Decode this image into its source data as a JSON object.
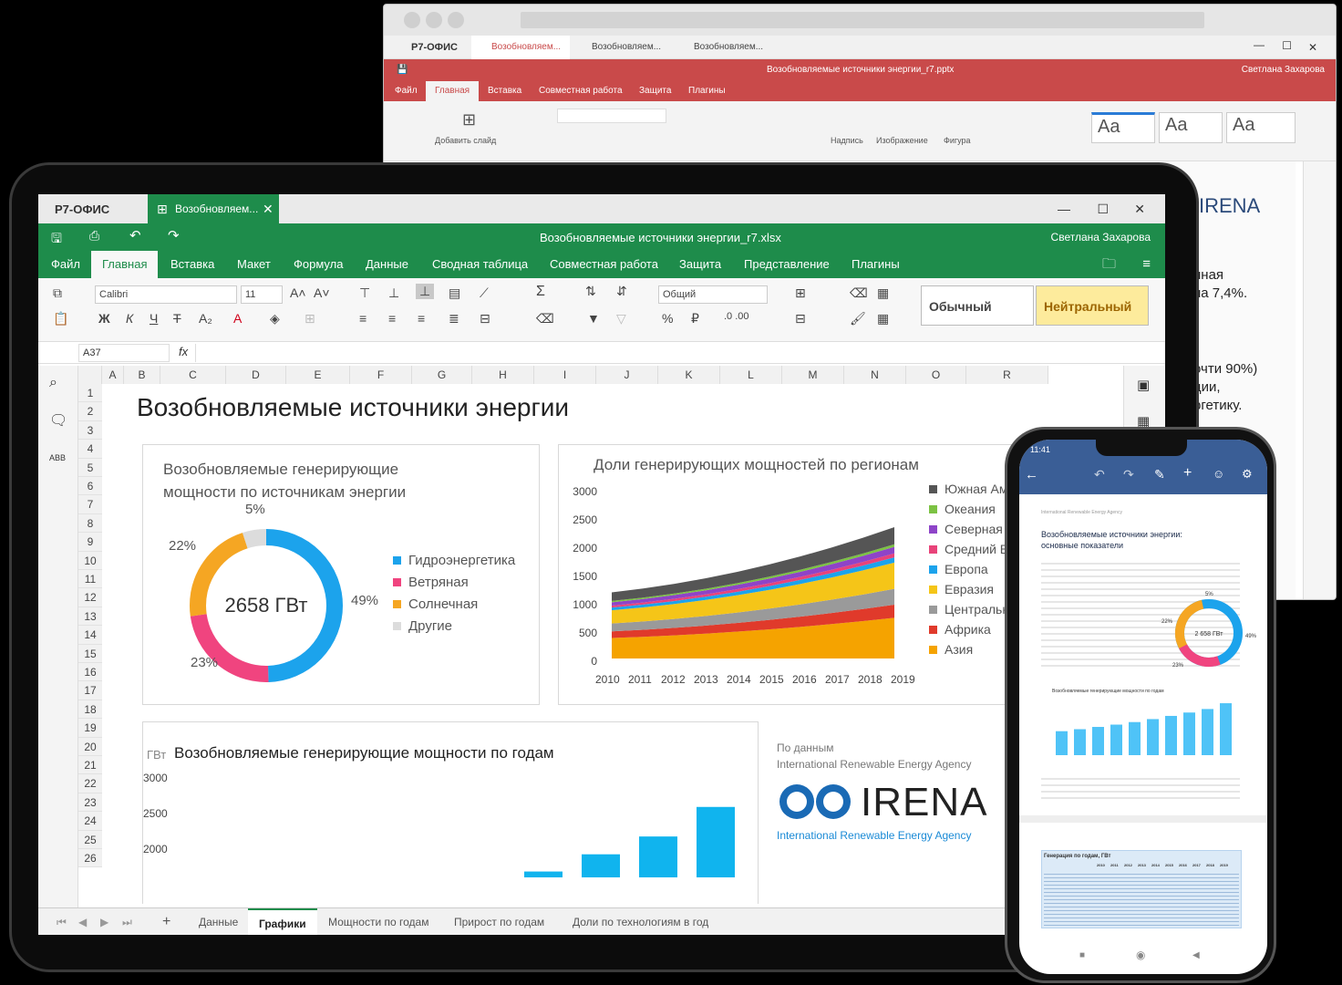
{
  "pres": {
    "logo": "Р7-ОФИС",
    "tabs": [
      "Возобновляем...",
      "Возобновляем...",
      "Возобновляем..."
    ],
    "file": "Возобновляемые источники энергии_r7.pptx",
    "user": "Светлана Захарова",
    "menu": [
      "Файл",
      "Главная",
      "Вставка",
      "Совместная работа",
      "Защита",
      "Плагины"
    ],
    "ribbon": {
      "add_slide": "Добавить слайд",
      "caption": "Надпись",
      "image": "Изображение",
      "shape": "Фигура",
      "theme": "Aa"
    },
    "visible_text": [
      "IRENA",
      "нная",
      "на 7,4%.",
      "очти 90%)",
      "ции,",
      "ргетику."
    ]
  },
  "sheet": {
    "logo": "Р7-ОФИС",
    "tab": "Возобновляем...",
    "file": "Возобновляемые источники энергии_r7.xlsx",
    "user": "Светлана Захарова",
    "menu": [
      "Файл",
      "Главная",
      "Вставка",
      "Макет",
      "Формула",
      "Данные",
      "Сводная таблица",
      "Совместная работа",
      "Защита",
      "Представление",
      "Плагины"
    ],
    "font": "Calibri",
    "size": "11",
    "number_format": "Общий",
    "styles": [
      "Обычный",
      "Нейтральный"
    ],
    "cell": "A37",
    "fx": "fx",
    "columns": [
      "A",
      "B",
      "C",
      "D",
      "E",
      "F",
      "G",
      "H",
      "I",
      "J",
      "K",
      "L",
      "M",
      "N",
      "O",
      "R"
    ],
    "rows": [
      "1",
      "2",
      "3",
      "4",
      "5",
      "6",
      "7",
      "8",
      "9",
      "10",
      "11",
      "12",
      "13",
      "14",
      "15",
      "16",
      "17",
      "18",
      "19",
      "20",
      "21",
      "22",
      "23",
      "24",
      "25",
      "26"
    ],
    "heading": "Возобновляемые источники энергии",
    "source_label": "По данным",
    "source_name": "International Renewable Energy Agency",
    "irena_logo": "IRENA",
    "irena_sub": "International Renewable Energy Agency",
    "sheet_tabs": [
      "Данные",
      "Графики",
      "Мощности по годам",
      "Прирост по годам",
      "Доли по технологиям в год"
    ],
    "side_labels": [
      "ABB"
    ]
  },
  "chart_data": [
    {
      "type": "pie",
      "title": "Возобновляемые генерирующие мощности по источникам энергии",
      "center": "2658 ГВт",
      "labels": [
        "Гидроэнергетика",
        "Ветряная",
        "Солнечная",
        "Другие"
      ],
      "values": [
        49,
        23,
        22,
        5
      ],
      "value_labels": [
        "49%",
        "23%",
        "22%",
        "5%"
      ],
      "colors": [
        "#1ca3ec",
        "#f0447f",
        "#f5a623",
        "#dcdcdc"
      ]
    },
    {
      "type": "area",
      "title": "Доли генерирующих мощностей по регионам",
      "x": [
        "2010",
        "2011",
        "2012",
        "2013",
        "2014",
        "2015",
        "2016",
        "2017",
        "2018",
        "2019"
      ],
      "ylim": [
        0,
        3000
      ],
      "yticks": [
        "3000",
        "2500",
        "2000",
        "1500",
        "1000",
        "500",
        "0"
      ],
      "legend": [
        "Южная Ам",
        "Океания",
        "Северная",
        "Средний В",
        "Европа",
        "Евразия",
        "Центральн",
        "Африка",
        "Азия"
      ],
      "colors": [
        "#555555",
        "#7cc243",
        "#8e44c8",
        "#e8437a",
        "#1ca3ec",
        "#f5c518",
        "#9a9a9a",
        "#e03a2b",
        "#f5a300"
      ]
    },
    {
      "type": "bar",
      "title": "Возобновляемые генерирующие мощности по годам",
      "ylabel": "ГВт",
      "yticks": [
        "3000",
        "2500",
        "2000"
      ],
      "ylim": [
        1950,
        3050
      ],
      "values": [
        1227,
        1329,
        1445,
        1563,
        1693,
        1846,
        2009,
        2182,
        2361,
        2658
      ],
      "color": "#10b4ee"
    }
  ],
  "phone": {
    "time": "11:41",
    "doc_source": "International Renewable Energy Agency",
    "doc_title": "Возобновляемые источники энергии: основные показатели",
    "donut_center": "2 658 ГВт",
    "pcts": [
      "5%",
      "22%",
      "23%",
      "49%"
    ],
    "bar_title": "Возобновляемые генерирующие мощности по годам",
    "gen_title": "Генерация по годам, ГВт",
    "years": [
      "2010",
      "2011",
      "2012",
      "2013",
      "2014",
      "2015",
      "2016",
      "2017",
      "2018",
      "2019"
    ],
    "bar_values": [
      1227,
      1329,
      1445,
      1563,
      1693,
      1846,
      2009,
      2182,
      2361,
      2658
    ]
  }
}
